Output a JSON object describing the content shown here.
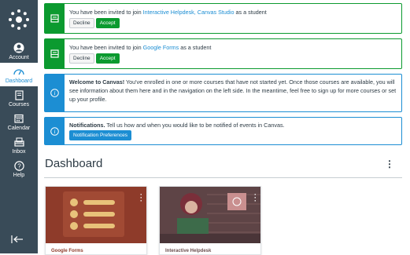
{
  "nav": {
    "items": [
      {
        "label": "Account",
        "icon": "account-icon"
      },
      {
        "label": "Dashboard",
        "icon": "dashboard-icon"
      },
      {
        "label": "Courses",
        "icon": "courses-icon"
      },
      {
        "label": "Calendar",
        "icon": "calendar-icon"
      },
      {
        "label": "Inbox",
        "icon": "inbox-icon"
      },
      {
        "label": "Help",
        "icon": "help-icon"
      }
    ]
  },
  "invites": [
    {
      "prefix": "You have been invited to join ",
      "course": "Interactive Helpdesk, Canvas Studio",
      "suffix": " as a student",
      "decline": "Decline",
      "accept": "Accept"
    },
    {
      "prefix": "You have been invited to join ",
      "course": "Google Forms",
      "suffix": " as a student",
      "decline": "Decline",
      "accept": "Accept"
    }
  ],
  "welcome": {
    "title": "Welcome to Canvas!",
    "text": "  You've enrolled in one or more courses that have not started yet. Once those courses are available, you will see information about them here and in the navigation on the left side. In the meantime, feel free to sign up for more courses or set up your profile."
  },
  "notifications": {
    "title": "Notifications.",
    "text": "  Tell us how and when you would like to be notified of events in Canvas.",
    "button": "Notification Preferences"
  },
  "dashboard": {
    "title": "Dashboard",
    "menu": "⋮"
  },
  "cards": [
    {
      "name": "Google Forms",
      "color": "#8e3b2a"
    },
    {
      "name": "Interactive Helpdesk",
      "color": "#6b4e4e"
    }
  ],
  "colors": {
    "nav": "#394b58",
    "green": "#0b9a2f",
    "blue": "#1c8ed3"
  }
}
